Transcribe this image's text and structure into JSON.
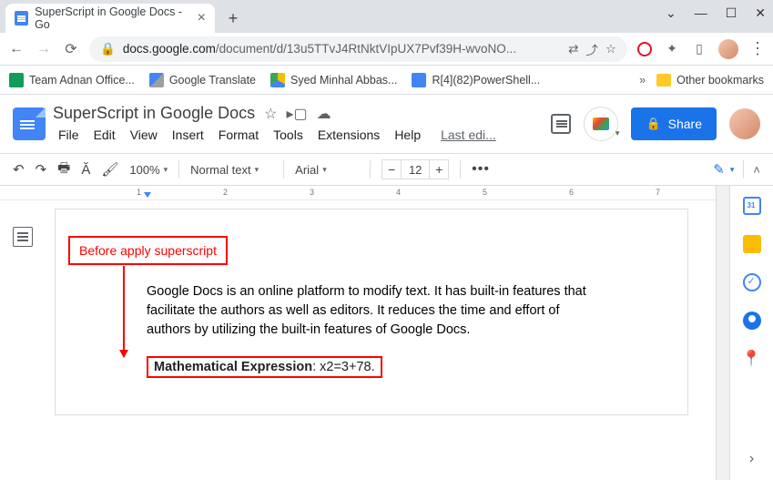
{
  "browser": {
    "tab_title": "SuperScript in Google Docs - Go",
    "url_host": "docs.google.com",
    "url_path": "/document/d/13u5TTvJ4RtNktVIpUX7Pvf39H-wvoNO..."
  },
  "bookmarks": {
    "b1": "Team Adnan Office...",
    "b2": "Google Translate",
    "b3": "Syed Minhal Abbas...",
    "b4": "R[4](82)PowerShell...",
    "other": "Other bookmarks"
  },
  "doc": {
    "title": "SuperScript in Google Docs",
    "last_edit": "Last edi..."
  },
  "menus": {
    "file": "File",
    "edit": "Edit",
    "view": "View",
    "insert": "Insert",
    "format": "Format",
    "tools": "Tools",
    "extensions": "Extensions",
    "help": "Help"
  },
  "toolbar": {
    "zoom": "100%",
    "style": "Normal text",
    "font": "Arial",
    "size": "12"
  },
  "share": "Share",
  "ruler": {
    "m1": "1",
    "m2": "2",
    "m3": "3",
    "m4": "4",
    "m5": "5",
    "m6": "6",
    "m7": "7"
  },
  "annotation": "Before apply superscript",
  "body": {
    "para": "Google Docs is an online platform to modify text. It has built-in features that facilitate the authors as well as editors. It reduces the time and effort of authors by utilizing the built-in features of Google Docs.",
    "expr_label": "Mathematical Expression",
    "expr_value": ": x2=3+78."
  }
}
